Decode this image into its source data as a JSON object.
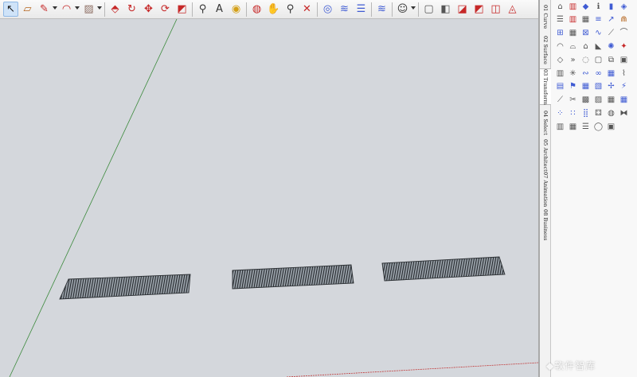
{
  "colors": {
    "viewport_bg": "#d4d7dc",
    "green_axis": "#3c8a3c",
    "red_axis": "#c23b3b",
    "patch_fill": "#9ba3ab",
    "hatch": "#1e2226",
    "icon_red": "#c62828",
    "icon_blue": "#3f5bd3"
  },
  "toolbar": {
    "tools": [
      {
        "name": "select-tool-icon",
        "glyph": "↖",
        "color": "#1a1a1a",
        "selected": true
      },
      {
        "name": "eraser-tool-icon",
        "glyph": "▱",
        "color": "#b5651d"
      },
      {
        "name": "pencil-line-tool-icon",
        "glyph": "✎",
        "color": "#c62828",
        "dropdown": true
      },
      {
        "name": "arc-tool-icon",
        "glyph": "◠",
        "color": "#c62828",
        "dropdown": true
      },
      {
        "name": "rectangle-tool-icon",
        "glyph": "▨",
        "color": "#8d6e63",
        "dropdown": true
      },
      {
        "name": "push-pull-tool-icon",
        "glyph": "⬘",
        "color": "#c62828",
        "sep_before": true
      },
      {
        "name": "follow-me-tool-icon",
        "glyph": "↻",
        "color": "#c62828"
      },
      {
        "name": "move-tool-icon",
        "glyph": "✥",
        "color": "#c62828"
      },
      {
        "name": "rotate-tool-icon",
        "glyph": "⟳",
        "color": "#c62828"
      },
      {
        "name": "scale-tool-icon",
        "glyph": "◩",
        "color": "#c62828"
      },
      {
        "name": "tape-measure-tool-icon",
        "glyph": "⚲",
        "color": "#333333",
        "sep_before": true
      },
      {
        "name": "text-tool-icon",
        "glyph": "A",
        "color": "#333333"
      },
      {
        "name": "paint-bucket-tool-icon",
        "glyph": "◉",
        "color": "#d4a017"
      },
      {
        "name": "orbit-tool-icon",
        "glyph": "◍",
        "color": "#c62828",
        "sep_before": true
      },
      {
        "name": "pan-tool-icon",
        "glyph": "✋",
        "color": "#b5651d"
      },
      {
        "name": "zoom-tool-icon",
        "glyph": "⚲",
        "color": "#333333"
      },
      {
        "name": "zoom-extents-tool-icon",
        "glyph": "✕",
        "color": "#c62828"
      },
      {
        "name": "warehouse-icon",
        "glyph": "◎",
        "color": "#3f5bd3",
        "sep_before": true
      },
      {
        "name": "extension-warehouse-icon",
        "glyph": "≋",
        "color": "#3f5bd3"
      },
      {
        "name": "layout-stack-icon",
        "glyph": "☰",
        "color": "#3f5bd3"
      },
      {
        "name": "extensions-manager-icon",
        "glyph": "≋",
        "color": "#3f5bd3",
        "sep_before": true
      },
      {
        "name": "account-icon",
        "glyph": "☺",
        "color": "#333333",
        "dropdown": true,
        "sep_before": true
      },
      {
        "name": "section-plane-icon",
        "glyph": "▢",
        "color": "#555555",
        "sep_before": true
      },
      {
        "name": "solid-tool-icon",
        "glyph": "◧",
        "color": "#555555"
      },
      {
        "name": "outer-shell-icon",
        "glyph": "◪",
        "color": "#c62828"
      },
      {
        "name": "intersect-icon",
        "glyph": "◩",
        "color": "#c62828"
      },
      {
        "name": "union-icon",
        "glyph": "◫",
        "color": "#c62828"
      },
      {
        "name": "subtract-icon",
        "glyph": "◬",
        "color": "#c62828"
      }
    ]
  },
  "sidebar": {
    "tabs": [
      {
        "label": "01 Curve",
        "active": false
      },
      {
        "label": "02 Surface",
        "active": false
      },
      {
        "label": "03 Transform",
        "active": true
      },
      {
        "label": "04 Select",
        "active": false
      },
      {
        "label": "05 Architect",
        "active": false
      },
      {
        "label": "07 Animation",
        "active": false
      },
      {
        "label": "08 Business",
        "active": false
      }
    ],
    "icon_rows": [
      [
        [
          "house-outline-icon",
          "⌂",
          "#555555"
        ],
        [
          "bars-icon",
          "▥",
          "#c62828"
        ],
        [
          "diamond-icon",
          "◆",
          "#3f5bd3"
        ],
        [
          "info-icon",
          "ℹ",
          "#555555"
        ],
        [
          "phone-icon",
          "▮",
          "#3f5bd3"
        ],
        [
          "cube-icon",
          "◈",
          "#3f5bd3"
        ]
      ],
      [
        [
          "stairs-icon",
          "☰",
          "#555555"
        ],
        [
          "columns-icon",
          "▥",
          "#c62828"
        ],
        [
          "lattice-icon",
          "▦",
          "#555555"
        ],
        [
          "stack-icon",
          "≡",
          "#3f5bd3"
        ],
        [
          "arrow-icon",
          "↗",
          "#3f5bd3"
        ],
        [
          "arch-icon",
          "⋒",
          "#b5651d"
        ]
      ],
      [
        [
          "rail-icon",
          "⊞",
          "#3f5bd3"
        ],
        [
          "grid-icon",
          "▦",
          "#555555"
        ],
        [
          "cross-hatch-icon",
          "⊠",
          "#3f5bd3"
        ],
        [
          "tilde-icon",
          "∿",
          "#3f5bd3"
        ],
        [
          "ramp-icon",
          "⟋",
          "#555555"
        ],
        [
          "bridge-icon",
          "⌒",
          "#555555"
        ]
      ],
      [
        [
          "dome-icon",
          "◠",
          "#555555"
        ],
        [
          "roof-curve-icon",
          "⌓",
          "#555555"
        ],
        [
          "gable-icon",
          "⌂",
          "#555555"
        ],
        [
          "wedge-icon",
          "◣",
          "#555555"
        ],
        [
          "seal-icon",
          "✺",
          "#3f5bd3"
        ],
        [
          "gift-icon",
          "✦",
          "#c62828"
        ]
      ],
      [
        [
          "lens-icon",
          "◇",
          "#555555"
        ],
        [
          "chevrons-icon",
          "»",
          "#555555"
        ],
        [
          "ring-icon",
          "◌",
          "#555555"
        ],
        [
          "square-icon",
          "▢",
          "#555555"
        ],
        [
          "frame-icon",
          "⧉",
          "#555555"
        ],
        [
          "box-icon",
          "▣",
          "#555555"
        ]
      ],
      [
        [
          "curtain-icon",
          "▥",
          "#555555"
        ],
        [
          "star-wire-icon",
          "✳",
          "#555555"
        ],
        [
          "spring-icon",
          "∾",
          "#3f5bd3"
        ],
        [
          "lemniscate-icon",
          "∞",
          "#3f5bd3"
        ],
        [
          "grid-warp-icon",
          "▦",
          "#3f5bd3"
        ],
        [
          "ribbon-icon",
          "⌇",
          "#555555"
        ]
      ],
      [
        [
          "blocks-icon",
          "▤",
          "#3f5bd3"
        ],
        [
          "flag-icon",
          "⚑",
          "#3f5bd3"
        ],
        [
          "panel-icon",
          "▦",
          "#3f5bd3"
        ],
        [
          "sheet-icon",
          "▧",
          "#3f5bd3"
        ],
        [
          "twist-icon",
          "✢",
          "#3f5bd3"
        ],
        [
          "bolt-icon",
          "⚡",
          "#3f5bd3"
        ]
      ],
      [
        [
          "fold-icon",
          "⟋",
          "#555555"
        ],
        [
          "cut-icon",
          "✂",
          "#555555"
        ],
        [
          "tile-icon",
          "▩",
          "#555555"
        ],
        [
          "plate-icon",
          "▨",
          "#555555"
        ],
        [
          "mesh-icon",
          "▦",
          "#555555"
        ],
        [
          "checker-icon",
          "▦",
          "#3f5bd3"
        ]
      ],
      [
        [
          "dots-icon",
          "⁘",
          "#3f5bd3"
        ],
        [
          "array-icon",
          "∷",
          "#3f5bd3"
        ],
        [
          "pixels-icon",
          "⣿",
          "#3f5bd3"
        ],
        [
          "dice-icon",
          "⚃",
          "#555555"
        ],
        [
          "sphere-icon",
          "◍",
          "#555555"
        ],
        [
          "link-icon",
          "⧓",
          "#555555"
        ]
      ],
      [
        [
          "bars-dim-icon",
          "▥",
          "#555555"
        ],
        [
          "fence-icon",
          "▦",
          "#555555"
        ],
        [
          "list-icon",
          "☰",
          "#555555"
        ],
        [
          "bulb-icon",
          "◯",
          "#555555"
        ],
        [
          "camera-icon",
          "▣",
          "#555555"
        ]
      ]
    ]
  },
  "watermark": {
    "text": "◆软件智库"
  }
}
